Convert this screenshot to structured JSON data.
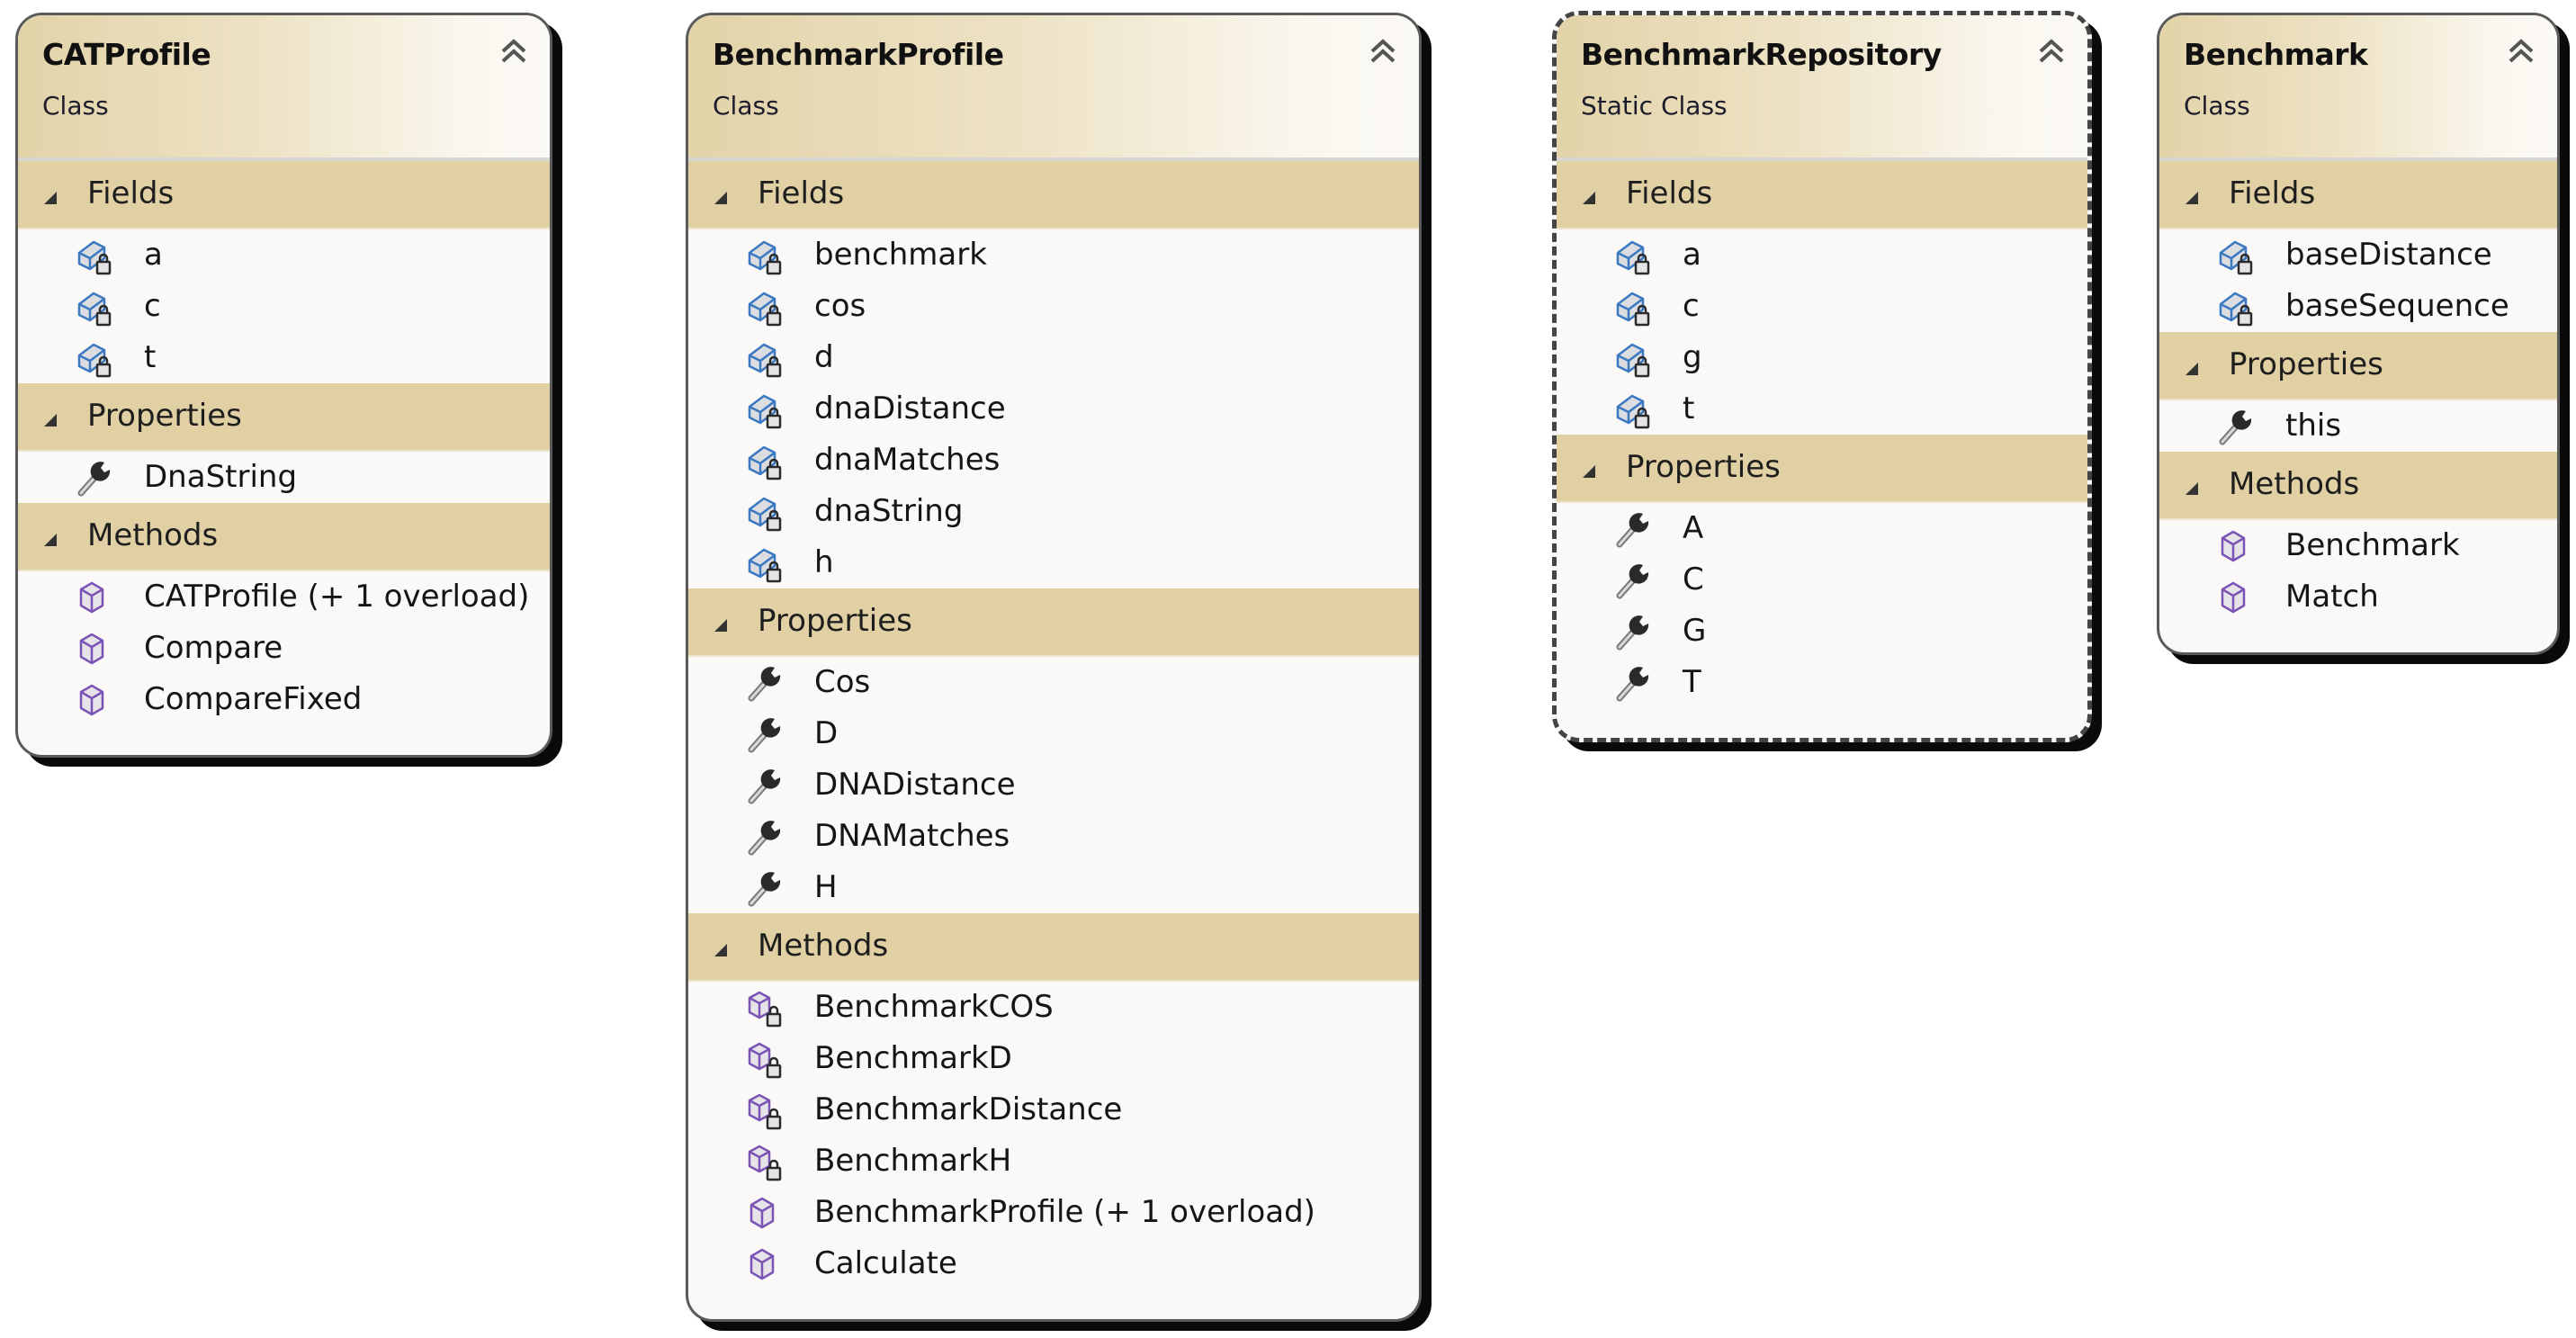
{
  "diagram": {
    "collapse_icon": "double-chevron-up-icon",
    "section_expander_icon": "expanded-triangle-icon",
    "colors": {
      "header_tan": "#e0d0a4",
      "body_bg": "#faf9f7",
      "field_icon_blue": "#3a78c2",
      "method_icon_purple": "#7b55b5",
      "wrench_dark": "#2a2a2a"
    },
    "classes": [
      {
        "name": "CATProfile",
        "kind": "Class",
        "sections": [
          {
            "label": "Fields",
            "items": [
              {
                "name": "a",
                "icon": "private-field-icon"
              },
              {
                "name": "c",
                "icon": "private-field-icon"
              },
              {
                "name": "t",
                "icon": "private-field-icon"
              }
            ]
          },
          {
            "label": "Properties",
            "items": [
              {
                "name": "DnaString",
                "icon": "property-wrench-icon"
              }
            ]
          },
          {
            "label": "Methods",
            "items": [
              {
                "name": "CATProfile (+ 1 overload)",
                "icon": "public-method-icon"
              },
              {
                "name": "Compare",
                "icon": "public-method-icon"
              },
              {
                "name": "CompareFixed",
                "icon": "public-method-icon"
              }
            ]
          }
        ]
      },
      {
        "name": "BenchmarkProfile",
        "kind": "Class",
        "sections": [
          {
            "label": "Fields",
            "items": [
              {
                "name": "benchmark",
                "icon": "private-field-icon"
              },
              {
                "name": "cos",
                "icon": "private-field-icon"
              },
              {
                "name": "d",
                "icon": "private-field-icon"
              },
              {
                "name": "dnaDistance",
                "icon": "private-field-icon"
              },
              {
                "name": "dnaMatches",
                "icon": "private-field-icon"
              },
              {
                "name": "dnaString",
                "icon": "private-field-icon"
              },
              {
                "name": "h",
                "icon": "private-field-icon"
              }
            ]
          },
          {
            "label": "Properties",
            "items": [
              {
                "name": "Cos",
                "icon": "property-wrench-icon"
              },
              {
                "name": "D",
                "icon": "property-wrench-icon"
              },
              {
                "name": "DNADistance",
                "icon": "property-wrench-icon"
              },
              {
                "name": "DNAMatches",
                "icon": "property-wrench-icon"
              },
              {
                "name": "H",
                "icon": "property-wrench-icon"
              }
            ]
          },
          {
            "label": "Methods",
            "items": [
              {
                "name": "BenchmarkCOS",
                "icon": "private-method-icon"
              },
              {
                "name": "BenchmarkD",
                "icon": "private-method-icon"
              },
              {
                "name": "BenchmarkDistance",
                "icon": "private-method-icon"
              },
              {
                "name": "BenchmarkH",
                "icon": "private-method-icon"
              },
              {
                "name": "BenchmarkProfile (+ 1 overload)",
                "icon": "public-method-icon"
              },
              {
                "name": "Calculate",
                "icon": "public-method-icon"
              }
            ]
          }
        ]
      },
      {
        "name": "BenchmarkRepository",
        "kind": "Static Class",
        "sections": [
          {
            "label": "Fields",
            "items": [
              {
                "name": "a",
                "icon": "private-field-icon"
              },
              {
                "name": "c",
                "icon": "private-field-icon"
              },
              {
                "name": "g",
                "icon": "private-field-icon"
              },
              {
                "name": "t",
                "icon": "private-field-icon"
              }
            ]
          },
          {
            "label": "Properties",
            "items": [
              {
                "name": "A",
                "icon": "property-wrench-icon"
              },
              {
                "name": "C",
                "icon": "property-wrench-icon"
              },
              {
                "name": "G",
                "icon": "property-wrench-icon"
              },
              {
                "name": "T",
                "icon": "property-wrench-icon"
              }
            ]
          }
        ]
      },
      {
        "name": "Benchmark",
        "kind": "Class",
        "sections": [
          {
            "label": "Fields",
            "items": [
              {
                "name": "baseDistance",
                "icon": "private-field-icon"
              },
              {
                "name": "baseSequence",
                "icon": "private-field-icon"
              }
            ]
          },
          {
            "label": "Properties",
            "items": [
              {
                "name": "this",
                "icon": "property-wrench-icon"
              }
            ]
          },
          {
            "label": "Methods",
            "items": [
              {
                "name": "Benchmark",
                "icon": "public-method-icon"
              },
              {
                "name": "Match",
                "icon": "public-method-icon"
              }
            ]
          }
        ]
      }
    ]
  }
}
